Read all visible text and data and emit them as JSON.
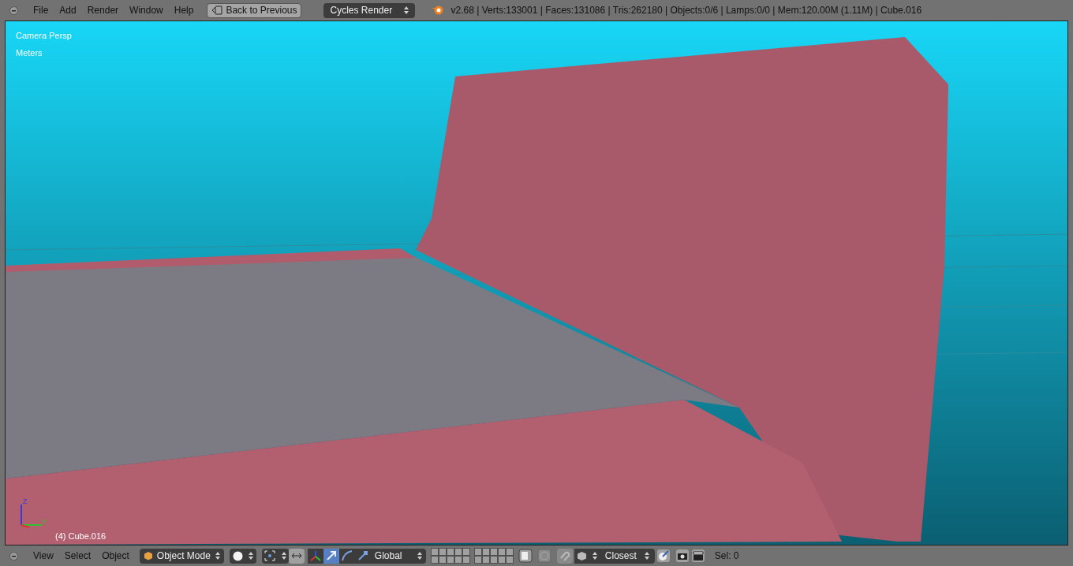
{
  "top_bar": {
    "menus": [
      "File",
      "Add",
      "Render",
      "Window",
      "Help"
    ],
    "back_button": "Back to Previous",
    "render_engine": "Cycles Render",
    "stats": "v2.68 | Verts:133001 | Faces:131086 | Tris:262180 | Objects:0/6 | Lamps:0/0 | Mem:120.00M (1.11M) | Cube.016"
  },
  "viewport": {
    "view_name": "Camera Persp",
    "units": "Meters",
    "object_label": "(4) Cube.016",
    "axis_labels": [
      "Z",
      "Y"
    ]
  },
  "bottom_bar": {
    "menus": [
      "View",
      "Select",
      "Object"
    ],
    "mode": "Object Mode",
    "manipulators": [
      {
        "kind": "axes",
        "selected": false
      },
      {
        "kind": "move",
        "selected": true
      },
      {
        "kind": "rotate",
        "selected": false
      },
      {
        "kind": "scale",
        "selected": false
      }
    ],
    "transform_orientation": "Global",
    "snap_enabled": false,
    "snap_target": "Closest",
    "selection_count": "Sel: 0"
  }
}
